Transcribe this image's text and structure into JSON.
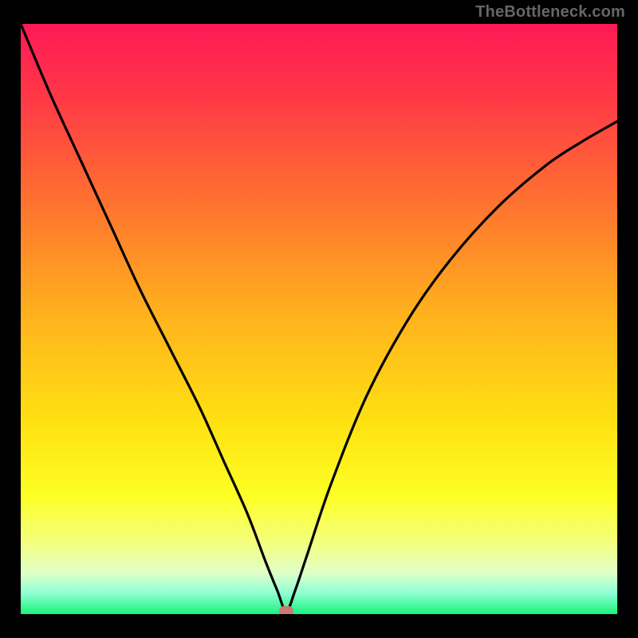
{
  "watermark": "TheBottleneck.com",
  "marker": {
    "x_frac": 0.445,
    "y_frac": 0.995,
    "color": "#ca7a77"
  },
  "gradient_stops": [
    {
      "offset": 0.0,
      "color": "#ff1956"
    },
    {
      "offset": 0.12,
      "color": "#ff3747"
    },
    {
      "offset": 0.3,
      "color": "#ff7130"
    },
    {
      "offset": 0.5,
      "color": "#ffb41c"
    },
    {
      "offset": 0.68,
      "color": "#ffe212"
    },
    {
      "offset": 0.8,
      "color": "#fdff24"
    },
    {
      "offset": 0.88,
      "color": "#f3ff80"
    },
    {
      "offset": 0.93,
      "color": "#e0ffc8"
    },
    {
      "offset": 0.965,
      "color": "#8cffd2"
    },
    {
      "offset": 1.0,
      "color": "#18f47a"
    }
  ],
  "chart_data": {
    "type": "line",
    "title": "",
    "xlabel": "",
    "ylabel": "",
    "xlim": [
      0,
      1
    ],
    "ylim": [
      0,
      1
    ],
    "note": "Bottleneck-style V curve. x is normalized horizontal position across the plot area, y is normalized height (0 at bottom, 1 at top). Minimum at x≈0.445.",
    "series": [
      {
        "name": "left-branch",
        "x": [
          0.0,
          0.05,
          0.1,
          0.15,
          0.2,
          0.25,
          0.3,
          0.34,
          0.38,
          0.41,
          0.43,
          0.445
        ],
        "y": [
          1.0,
          0.88,
          0.77,
          0.66,
          0.55,
          0.45,
          0.35,
          0.26,
          0.17,
          0.09,
          0.04,
          0.005
        ]
      },
      {
        "name": "right-branch",
        "x": [
          0.445,
          0.46,
          0.48,
          0.52,
          0.58,
          0.65,
          0.72,
          0.8,
          0.88,
          0.94,
          1.0
        ],
        "y": [
          0.005,
          0.04,
          0.1,
          0.22,
          0.37,
          0.5,
          0.6,
          0.69,
          0.76,
          0.8,
          0.835
        ]
      }
    ],
    "marker": {
      "x": 0.445,
      "y": 0.005
    }
  }
}
